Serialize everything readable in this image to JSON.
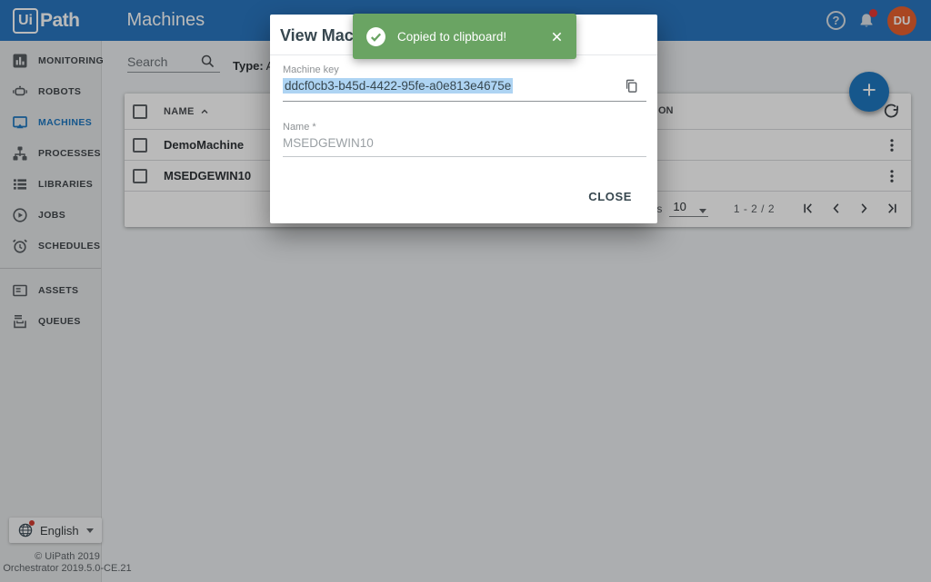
{
  "header": {
    "logo_ui": "Ui",
    "logo_path": "Path",
    "page_title": "Machines",
    "avatar_initials": "DU",
    "help_glyph": "?"
  },
  "sidebar": {
    "active_item": "MACHINES",
    "items": [
      {
        "label": "MONITORING",
        "icon": "bar-chart-icon"
      },
      {
        "label": "ROBOTS",
        "icon": "robot-icon"
      },
      {
        "label": "MACHINES",
        "icon": "monitor-icon"
      },
      {
        "label": "PROCESSES",
        "icon": "sitemap-icon"
      },
      {
        "label": "LIBRARIES",
        "icon": "list-icon"
      },
      {
        "label": "JOBS",
        "icon": "play-circle-icon"
      },
      {
        "label": "SCHEDULES",
        "icon": "alarm-clock-icon"
      },
      {
        "label": "ASSETS",
        "icon": "asset-card-icon"
      },
      {
        "label": "QUEUES",
        "icon": "queue-tray-icon"
      }
    ]
  },
  "toolbar": {
    "search_placeholder": "Search",
    "type_label": "Type:",
    "type_value": "All"
  },
  "table": {
    "name_header": "NAME",
    "partial_header_fragment": "ON",
    "rows": [
      {
        "name": "DemoMachine"
      },
      {
        "name": "MSEDGEWIN10"
      }
    ]
  },
  "pagination": {
    "items_label": "Items",
    "page_size": "10",
    "range": "1 - 2 / 2"
  },
  "dialog": {
    "title": "View Machine",
    "machine_key_label": "Machine key",
    "machine_key_value": "ddcf0cb3-b45d-4422-95fe-a0e813e4675e",
    "name_label": "Name *",
    "name_value": "MSEDGEWIN10",
    "close_label": "CLOSE"
  },
  "toast": {
    "message": "Copied to clipboard!"
  },
  "language": {
    "label": "English"
  },
  "footer": {
    "copyright": "© UiPath 2019",
    "version": "Orchestrator 2019.5.0-CE.21"
  },
  "colors": {
    "header_blue": "#2a77c0",
    "accent_blue": "#1f78c1",
    "avatar_orange": "#e8602f",
    "toast_green": "#6aa463",
    "badge_red": "#e53935",
    "selection_blue": "#aed4f3"
  }
}
